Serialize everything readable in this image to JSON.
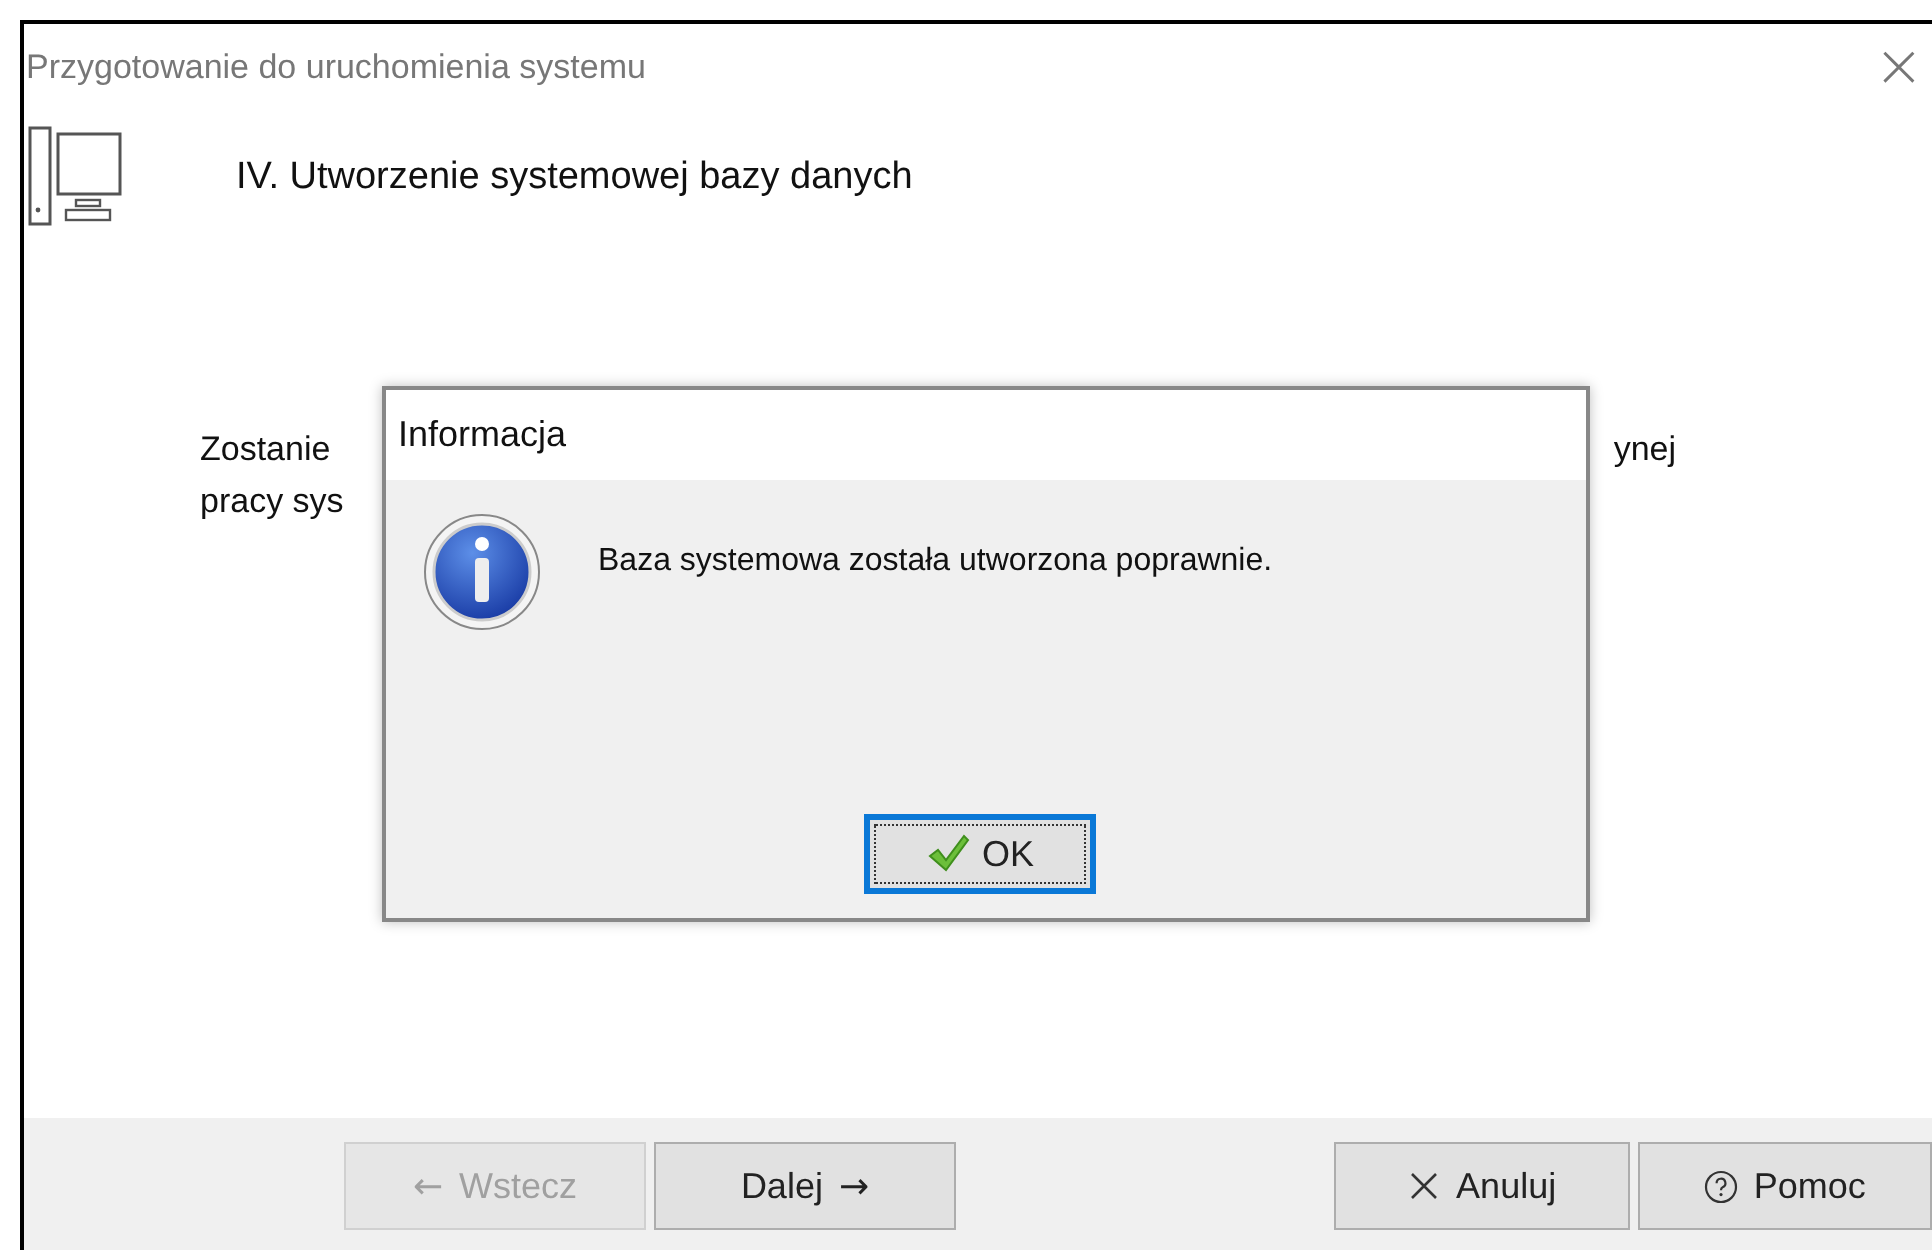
{
  "window": {
    "title": "Przygotowanie do uruchomienia systemu",
    "close_glyph": "×"
  },
  "header": {
    "title": "IV. Utworzenie systemowej bazy danych"
  },
  "body": {
    "left_lines": [
      "Zostanie",
      "pracy sys"
    ],
    "right_fragment": "ynej"
  },
  "buttons": [
    {
      "kind": "back",
      "arrow": "←",
      "label": "Wstecz",
      "disabled": true
    },
    {
      "kind": "next",
      "arrow": "→",
      "label": "Dalej",
      "disabled": false
    },
    {
      "kind": "cancel",
      "label": "Anuluj",
      "disabled": false
    },
    {
      "kind": "help",
      "label": "Pomoc",
      "disabled": false
    }
  ],
  "dialog": {
    "title": "Informacja",
    "message": "Baza systemowa została utworzona poprawnie.",
    "button": "OK"
  }
}
